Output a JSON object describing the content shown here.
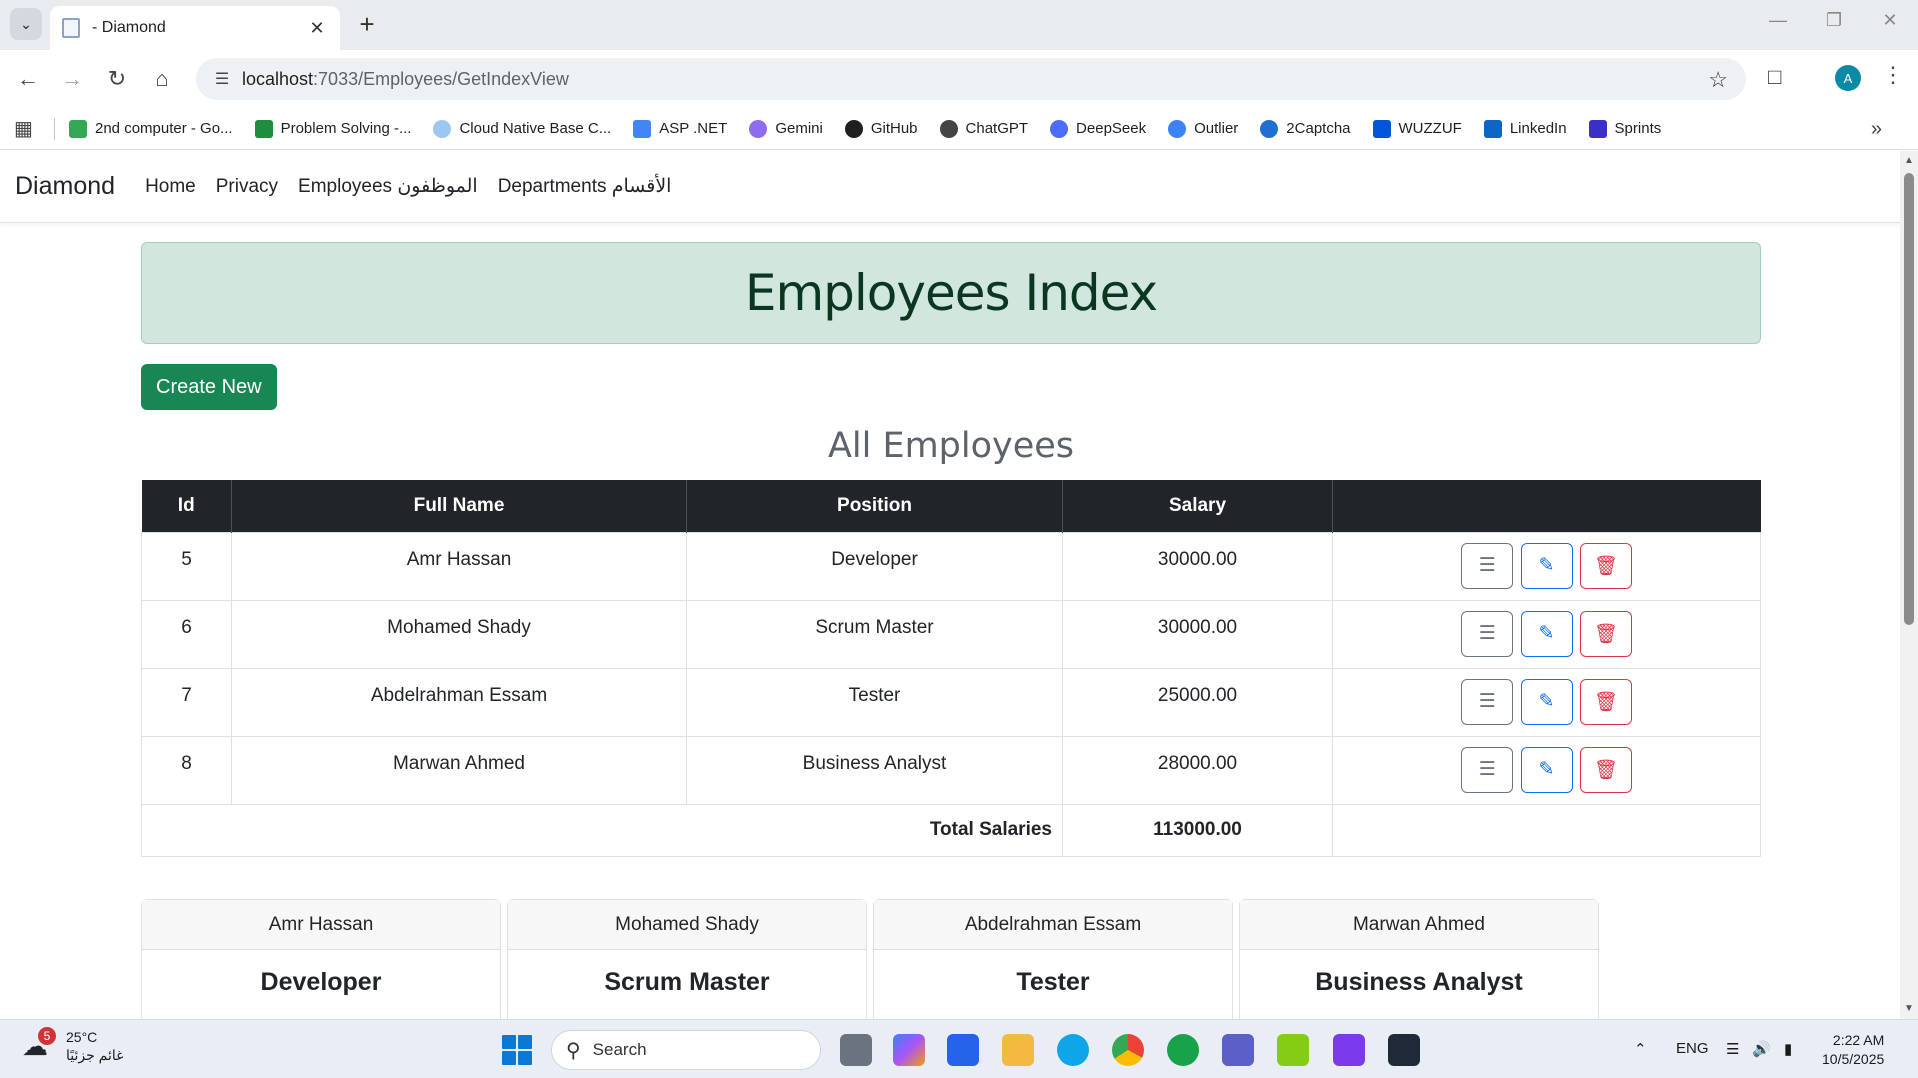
{
  "browser": {
    "tab_title": "- Diamond",
    "url_host": "localhost",
    "url_path": ":7033/Employees/GetIndexView",
    "bookmarks": [
      {
        "label": "2nd computer - Go...",
        "color": "#34a853"
      },
      {
        "label": "Problem Solving -...",
        "color": "#1e8e3e"
      },
      {
        "label": "Cloud Native Base C...",
        "color": "#4285f4"
      },
      {
        "label": "ASP .NET",
        "color": "#4285f4"
      },
      {
        "label": "Gemini",
        "color": "#8e6cf0"
      },
      {
        "label": "GitHub",
        "color": "#1f1f1f"
      },
      {
        "label": "ChatGPT",
        "color": "#1f1f1f"
      },
      {
        "label": "DeepSeek",
        "color": "#4d6bfe"
      },
      {
        "label": "Outlier",
        "color": "#3b82f6"
      },
      {
        "label": "2Captcha",
        "color": "#1f6fd1"
      },
      {
        "label": "WUZZUF",
        "color": "#0055d9"
      },
      {
        "label": "LinkedIn",
        "color": "#0a66c2"
      },
      {
        "label": "Sprints",
        "color": "#3b2fc9"
      }
    ],
    "profile_initial": "A"
  },
  "site": {
    "brand": "Diamond",
    "nav": [
      "Home",
      "Privacy",
      "Employees الموظفون",
      "Departments الأقسام"
    ]
  },
  "page": {
    "title": "Employees Index",
    "create_label": "Create New",
    "subheading": "All Employees"
  },
  "table": {
    "headers": [
      "Id",
      "Full Name",
      "Position",
      "Salary",
      ""
    ],
    "rows": [
      {
        "id": "5",
        "name": "Amr Hassan",
        "position": "Developer",
        "salary": "30000.00"
      },
      {
        "id": "6",
        "name": "Mohamed Shady",
        "position": "Scrum Master",
        "salary": "30000.00"
      },
      {
        "id": "7",
        "name": "Abdelrahman Essam",
        "position": "Tester",
        "salary": "25000.00"
      },
      {
        "id": "8",
        "name": "Marwan Ahmed",
        "position": "Business Analyst",
        "salary": "28000.00"
      }
    ],
    "total_label": "Total Salaries",
    "total_value": "113000.00"
  },
  "cards": [
    {
      "name": "Amr Hassan",
      "position": "Developer"
    },
    {
      "name": "Mohamed Shady",
      "position": "Scrum Master"
    },
    {
      "name": "Abdelrahman Essam",
      "position": "Tester"
    },
    {
      "name": "Marwan Ahmed",
      "position": "Business Analyst"
    }
  ],
  "taskbar": {
    "weather_temp": "25°C",
    "weather_desc": "غائم جزئيًا",
    "weather_badge": "5",
    "search_placeholder": "Search",
    "language": "ENG",
    "time": "2:22 AM",
    "date": "10/5/2025"
  },
  "colors": {
    "success": "#198754",
    "alert_bg": "#d1e7dd",
    "table_head": "#212529",
    "info": "#6c757d",
    "primary": "#0d6efd",
    "danger": "#dc3545"
  }
}
